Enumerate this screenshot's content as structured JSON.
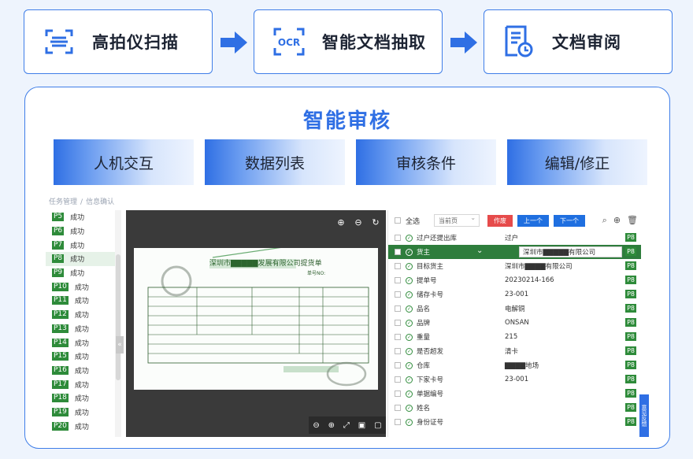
{
  "steps": [
    {
      "label": "高拍仪扫描",
      "icon": "scanner-icon"
    },
    {
      "label": "智能文档抽取",
      "icon": "ocr-icon",
      "icon_text": "OCR"
    },
    {
      "label": "文档审阅",
      "icon": "document-review-icon"
    }
  ],
  "main": {
    "title": "智能审核",
    "features": [
      "人机交互",
      "数据列表",
      "审核条件",
      "编辑/修正"
    ]
  },
  "screenshot": {
    "breadcrumb": [
      "任务管理",
      "信息确认"
    ],
    "pages": [
      {
        "tag": "P5",
        "status": "成功"
      },
      {
        "tag": "P6",
        "status": "成功"
      },
      {
        "tag": "P7",
        "status": "成功"
      },
      {
        "tag": "P8",
        "status": "成功"
      },
      {
        "tag": "P9",
        "status": "成功"
      },
      {
        "tag": "P10",
        "status": "成功"
      },
      {
        "tag": "P11",
        "status": "成功"
      },
      {
        "tag": "P12",
        "status": "成功"
      },
      {
        "tag": "P13",
        "status": "成功"
      },
      {
        "tag": "P14",
        "status": "成功"
      },
      {
        "tag": "P15",
        "status": "成功"
      },
      {
        "tag": "P16",
        "status": "成功"
      },
      {
        "tag": "P17",
        "status": "成功"
      },
      {
        "tag": "P18",
        "status": "成功"
      },
      {
        "tag": "P19",
        "status": "成功"
      },
      {
        "tag": "P20",
        "status": "成功"
      }
    ],
    "selected_page": "P8",
    "document": {
      "title": "深圳市▇▇▇▇▇发展有限公司提货单",
      "no_label": "单号NO:"
    },
    "toolbar": {
      "select_all": "全选",
      "scope": "当前页",
      "void": "作废",
      "prev": "上一个",
      "next": "下一个"
    },
    "fields": [
      {
        "name": "过户还提出库",
        "value": "过户",
        "page": "P8"
      },
      {
        "name": "货主",
        "value": "深圳市▇▇▇▇▇有限公司",
        "page": "P8",
        "active": true
      },
      {
        "name": "目标货主",
        "value": "深圳市▇▇▇▇有限公司",
        "page": "P8"
      },
      {
        "name": "提单号",
        "value": "20230214-166",
        "page": "P8"
      },
      {
        "name": "储存卡号",
        "value": "23-001",
        "page": "P8"
      },
      {
        "name": "品名",
        "value": "电解铜",
        "page": "P8"
      },
      {
        "name": "品牌",
        "value": "ONSAN",
        "page": "P8"
      },
      {
        "name": "重量",
        "value": "215",
        "page": "P8"
      },
      {
        "name": "是否超发",
        "value": "清卡",
        "page": "P8"
      },
      {
        "name": "仓库",
        "value": "▇▇▇▇地场",
        "page": "P8"
      },
      {
        "name": "下家卡号",
        "value": "23-001",
        "page": "P8"
      },
      {
        "name": "单据编号",
        "value": "",
        "page": "P8"
      },
      {
        "name": "姓名",
        "value": "",
        "page": "P8"
      },
      {
        "name": "身份证号",
        "value": "",
        "page": "P8"
      }
    ],
    "side_tab": "意见反馈"
  },
  "colors": {
    "accent": "#2f6fe4",
    "success": "#2e8b3a",
    "danger": "#e64b4b"
  }
}
